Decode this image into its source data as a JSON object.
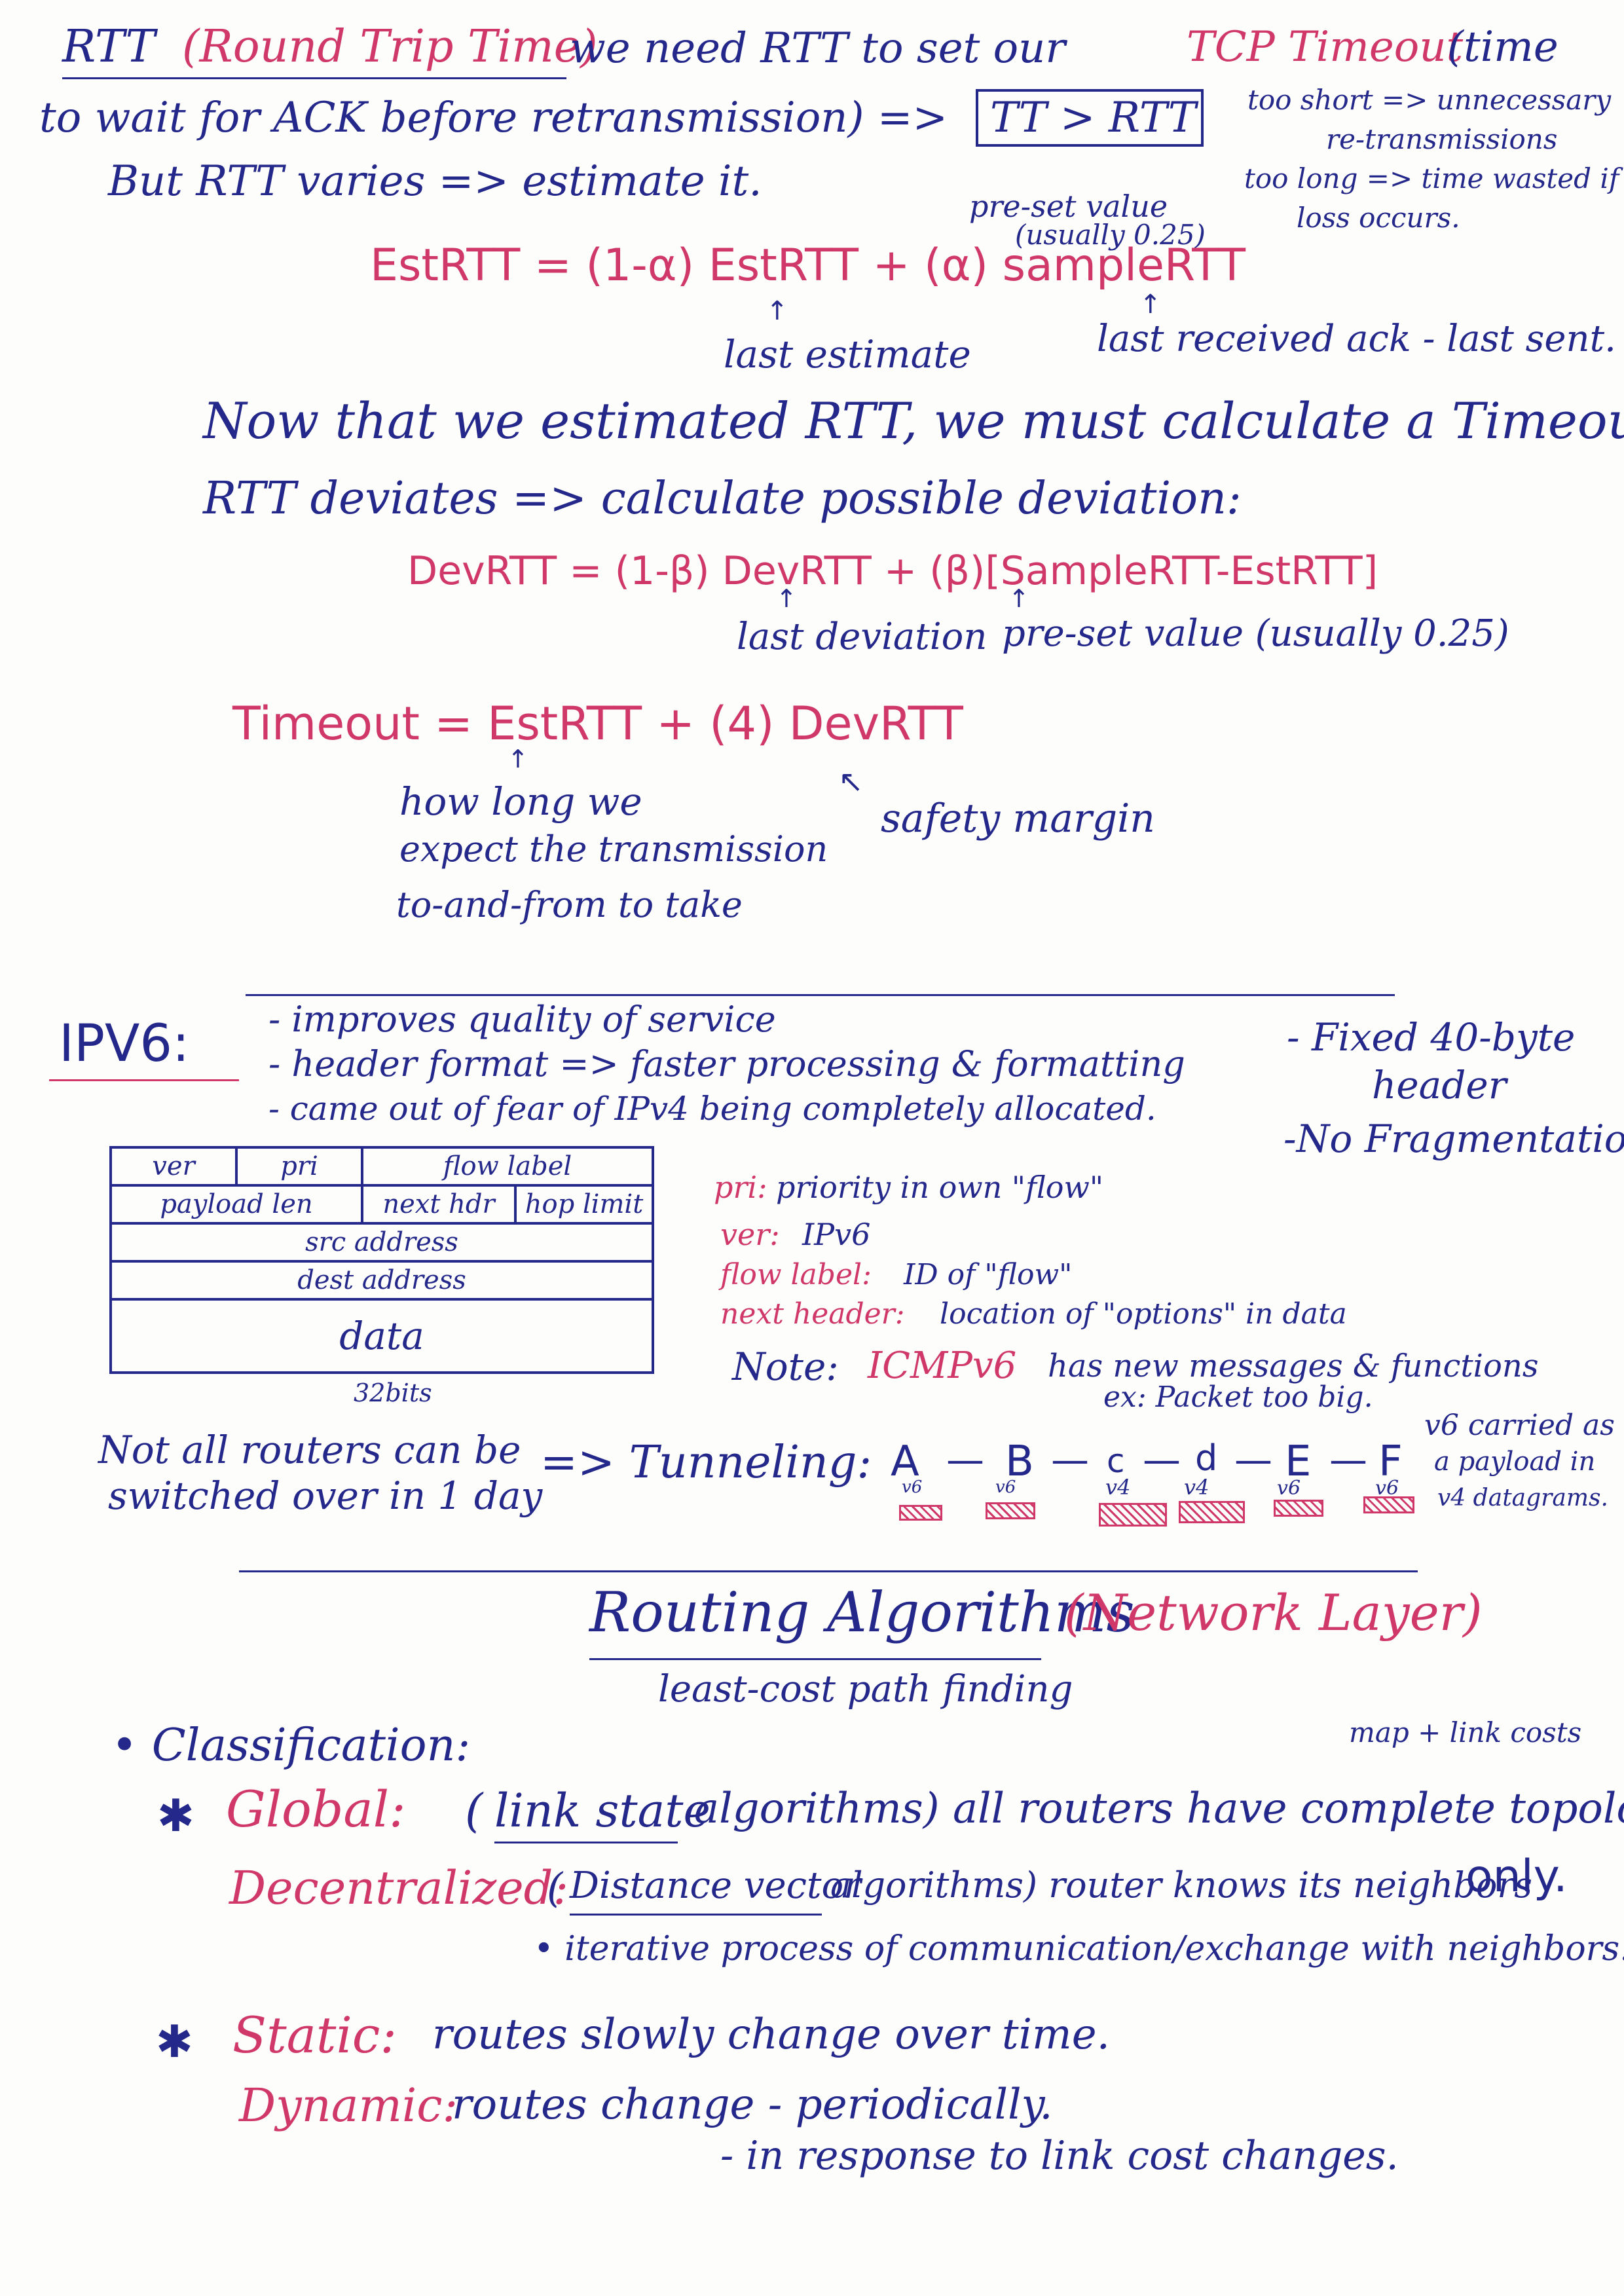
{
  "rtt": {
    "title": "RTT",
    "title_paren": "(Round Trip Time)",
    "line1_rest": "we need RTT to set our",
    "tcp_timeout": "TCP Timeout",
    "time_open": "(time",
    "line2": "to wait for ACK before retransmission) =>",
    "tt_box": "TT > RTT",
    "too_short_1": "too short => unnecessary",
    "too_short_2": "re-transmissions",
    "too_long_1": "too long => time wasted if",
    "too_long_2": "loss occurs.",
    "line3": "But RTT varies => estimate it.",
    "preset_label": "pre-set value",
    "preset_usual": "(usually 0.25)",
    "est_formula": "EstRTT = (1-α) EstRTT + (α) sampleRTT",
    "last_estimate": "last estimate",
    "last_received": "last received ack - last sent.",
    "now_line": "Now that we estimated RTT, we must calculate a Timeout.",
    "deviates_line": "RTT deviates => calculate possible deviation:",
    "dev_formula": "DevRTT = (1-β) DevRTT + (β)[SampleRTT-EstRTT]",
    "last_deviation": "last deviation",
    "preset_dev": "pre-set value (usually 0.25)",
    "timeout_formula": "Timeout = EstRTT + (4) DevRTT",
    "how_long_1": "how long we",
    "how_long_2": "expect the transmission",
    "how_long_3": "to-and-from to take",
    "safety": "safety margin"
  },
  "ipv6": {
    "title": "IPV6:",
    "b1": "- improves quality of service",
    "b2": "- header format => faster processing & formatting",
    "b3": "- came out of fear of IPv4 being completely allocated.",
    "fixed_1": "- Fixed 40-byte",
    "fixed_2": "header",
    "no_frag": "-No Fragmentation",
    "header_table": {
      "ver": "ver",
      "pri": "pri",
      "flow_label": "flow label",
      "payload_len": "payload len",
      "next_hdr": "next hdr",
      "hop_limit": "hop limit",
      "src": "src address",
      "dest": "dest address",
      "data": "data",
      "width": "32bits"
    },
    "defs": [
      {
        "term": "pri:",
        "desc": "priority in own \"flow\""
      },
      {
        "term": "ver:",
        "desc": "IPv6"
      },
      {
        "term": "flow label:",
        "desc": "ID of \"flow\""
      },
      {
        "term": "next header:",
        "desc": "location of \"options\" in data"
      }
    ],
    "note_label": "Note:",
    "note_icmp": "ICMPv6",
    "note_rest": "has new messages & functions",
    "note_ex": "ex: Packet too big.",
    "not_all_1": "Not all routers can be",
    "not_all_2": "switched over in 1 day",
    "tunneling": "=> Tunneling:",
    "tunnel_nodes": [
      {
        "name": "A",
        "ver": "v6"
      },
      {
        "name": "B",
        "ver": "v6"
      },
      {
        "name": "c",
        "ver": "v4"
      },
      {
        "name": "d",
        "ver": "v4"
      },
      {
        "name": "E",
        "ver": "v6"
      },
      {
        "name": "F",
        "ver": "v6"
      }
    ],
    "v6_carried_1": "v6 carried as",
    "v6_carried_2": "a payload in",
    "v6_carried_3": "v4 datagrams."
  },
  "routing": {
    "title": "Routing Algorithms",
    "title_paren": "(Network Layer)",
    "subtitle": "least-cost path finding",
    "classification": "• Classification:",
    "map_costs": "map + link costs",
    "global_label": "Global:",
    "global_rest_a": "(",
    "link_state": "link state",
    "global_rest_b": "algorithms) all routers have complete topology.",
    "decentral_label": "Decentralized:",
    "decentral_a": "(",
    "distance_vector": "Distance vector",
    "decentral_b": "algorithms) router knows its neighbors",
    "only": "only.",
    "iterative": "• iterative process of communication/exchange with neighbors.",
    "static_label": "Static:",
    "static_rest": "routes slowly change over time.",
    "dynamic_label": "Dynamic:",
    "dynamic_rest": "routes change - periodically.",
    "dynamic_2": "- in response to link cost changes."
  },
  "colors": {
    "blue_ink": "#24288a",
    "pink_ink": "#d0386a",
    "paper": "#fdfdfb"
  }
}
